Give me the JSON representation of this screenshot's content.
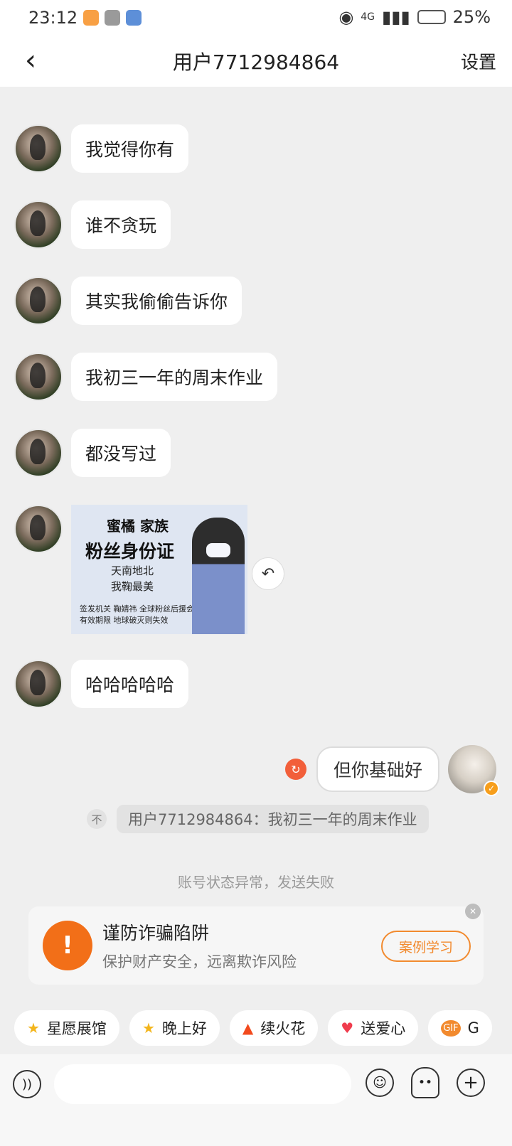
{
  "status_bar": {
    "time": "23:12",
    "network": "4G",
    "battery": "25%"
  },
  "header": {
    "back_icon": "‹",
    "title": "用户7712984864",
    "settings_label": "设置"
  },
  "messages": [
    {
      "text": "我觉得你有"
    },
    {
      "text": "谁不贪玩"
    },
    {
      "text": "其实我偷偷告诉你"
    },
    {
      "text": "我初三一年的周末作业"
    },
    {
      "text": "都没写过"
    },
    {
      "image_card": {
        "line1": "蜜橘  家族",
        "line2": "粉丝身份证",
        "line3": "天南地北",
        "line4": "我鞠最美",
        "line5": "签发机关 鞠婧祎 全球粉丝后援会",
        "line6": "有效期限  地球破灭则失效"
      }
    },
    {
      "text": "哈哈哈哈哈"
    }
  ],
  "self_message": {
    "text": "但你基础好"
  },
  "quote": {
    "icon": "不",
    "text": "用户7712984864：我初三一年的周末作业"
  },
  "system_tip": "账号状态异常，发送失败",
  "fraud_card": {
    "title": "谨防诈骗陷阱",
    "subtitle": "保护财产安全，远离欺诈风险",
    "button_label": "案例学习"
  },
  "quick_chips": [
    {
      "icon": "★",
      "label": "星愿展馆"
    },
    {
      "icon": "★",
      "label": "晚上好"
    },
    {
      "icon": "▲",
      "label": "续火花"
    },
    {
      "icon": "♥",
      "label": "送爱心"
    },
    {
      "icon": "GIF",
      "label": "G"
    }
  ],
  "colors": {
    "accent": "#f26f18",
    "chat_background": "#efefef",
    "bubble": "#ffffff"
  }
}
